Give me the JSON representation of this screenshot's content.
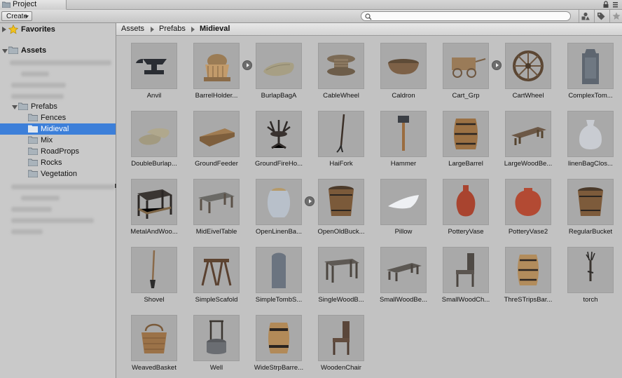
{
  "window": {
    "tab_title": "Project"
  },
  "toolbar": {
    "create_label": "Create",
    "search_placeholder": ""
  },
  "sidebar": {
    "favorites_label": "Favorites",
    "assets_label": "Assets",
    "prefabs_label": "Prefabs",
    "prefab_folders": [
      {
        "label": "Fences"
      },
      {
        "label": "Midieval"
      },
      {
        "label": "Mix"
      },
      {
        "label": "RoadProps"
      },
      {
        "label": "Rocks"
      },
      {
        "label": "Vegetation"
      }
    ]
  },
  "breadcrumb": {
    "items": [
      "Assets",
      "Prefabs",
      "Midieval"
    ]
  },
  "assets": [
    {
      "name": "Anvil",
      "icon": "anvil-icon"
    },
    {
      "name": "BarrelHolder...",
      "icon": "barrel-holder-icon"
    },
    {
      "name": "BurlapBagA",
      "icon": "burlap-bag-icon"
    },
    {
      "name": "CableWheel",
      "icon": "cable-wheel-icon"
    },
    {
      "name": "Caldron",
      "icon": "caldron-icon"
    },
    {
      "name": "Cart_Grp",
      "icon": "cart-icon"
    },
    {
      "name": "CartWheel",
      "icon": "cart-wheel-icon"
    },
    {
      "name": "ComplexTom...",
      "icon": "tombstone-icon"
    },
    {
      "name": "DoubleBurlap...",
      "icon": "double-burlap-icon"
    },
    {
      "name": "GroundFeeder",
      "icon": "ground-feeder-icon"
    },
    {
      "name": "GroundFireHo...",
      "icon": "fire-holder-icon"
    },
    {
      "name": "HaiFork",
      "icon": "hayfork-icon"
    },
    {
      "name": "Hammer",
      "icon": "hammer-icon"
    },
    {
      "name": "LargeBarrel",
      "icon": "barrel-icon"
    },
    {
      "name": "LargeWoodBe...",
      "icon": "bench-icon"
    },
    {
      "name": "linenBagClos...",
      "icon": "linen-bag-icon"
    },
    {
      "name": "MetalAndWoo...",
      "icon": "metal-table-icon"
    },
    {
      "name": "MidEivelTable",
      "icon": "table-icon"
    },
    {
      "name": "OpenLinenBa...",
      "icon": "open-linen-bag-icon"
    },
    {
      "name": "OpenOldBuck...",
      "icon": "bucket-icon"
    },
    {
      "name": "Pillow",
      "icon": "pillow-icon"
    },
    {
      "name": "PotteryVase",
      "icon": "vase-icon"
    },
    {
      "name": "PotteryVase2",
      "icon": "vase2-icon"
    },
    {
      "name": "RegularBucket",
      "icon": "bucket-icon"
    },
    {
      "name": "Shovel",
      "icon": "shovel-icon"
    },
    {
      "name": "SimpleScafold",
      "icon": "sawhorse-icon"
    },
    {
      "name": "SimpleTombS...",
      "icon": "tombstone-simple-icon"
    },
    {
      "name": "SingleWoodB...",
      "icon": "wood-bench-icon"
    },
    {
      "name": "SmallWoodBe...",
      "icon": "small-bench-icon"
    },
    {
      "name": "SmallWoodCh...",
      "icon": "small-chair-icon"
    },
    {
      "name": "ThreSTripsBar...",
      "icon": "strip-barrel-icon"
    },
    {
      "name": "torch",
      "icon": "torch-icon"
    },
    {
      "name": "WeavedBasket",
      "icon": "basket-icon"
    },
    {
      "name": "Well",
      "icon": "well-icon"
    },
    {
      "name": "WideStrpBarre...",
      "icon": "wide-barrel-icon"
    },
    {
      "name": "WoodenChair",
      "icon": "chair-icon"
    }
  ]
}
